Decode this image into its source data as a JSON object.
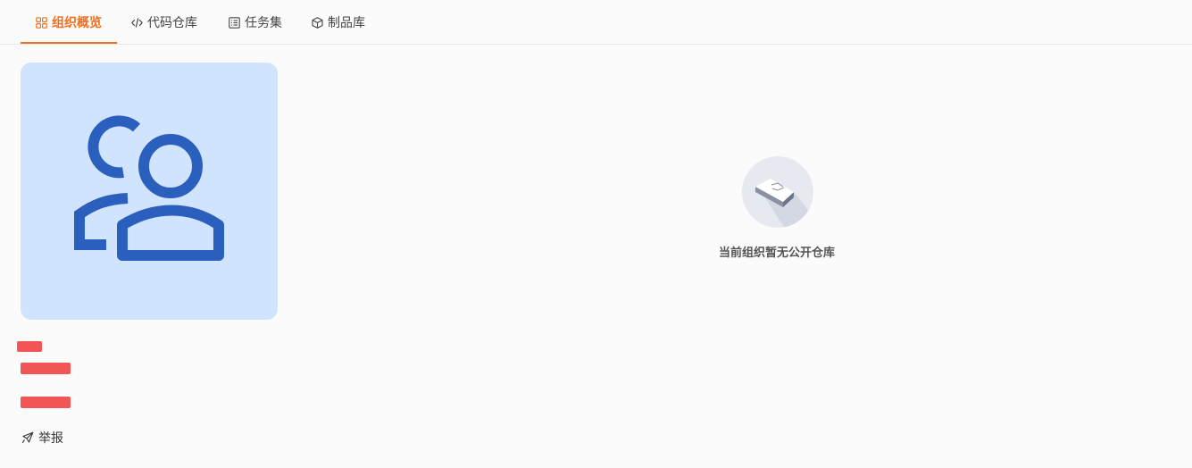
{
  "tabs": [
    {
      "label": "组织概览",
      "icon": "grid-icon",
      "active": true
    },
    {
      "label": "代码仓库",
      "icon": "code-icon",
      "active": false
    },
    {
      "label": "任务集",
      "icon": "list-icon",
      "active": false
    },
    {
      "label": "制品库",
      "icon": "box-icon",
      "active": false
    }
  ],
  "colors": {
    "accent": "#f0701f",
    "avatar_bg": "#d1e4fd",
    "avatar_fg": "#2b5fbe",
    "redaction": "#f25556"
  },
  "sidebar": {
    "report_label": "举报",
    "report_icon": "rocket-icon"
  },
  "empty_state": {
    "icon": "empty-box-icon",
    "message": "当前组织暂无公开仓库"
  }
}
